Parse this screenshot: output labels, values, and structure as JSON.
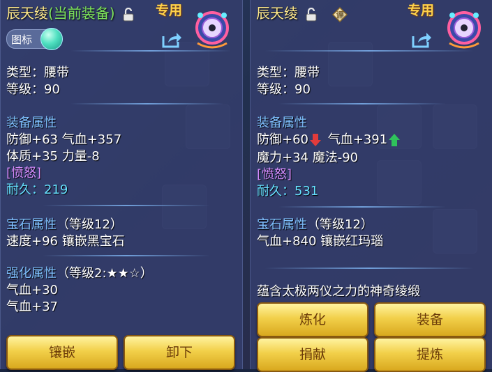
{
  "left_panel": {
    "item_name": "辰天绫",
    "current_equipped_tag": "(当前装备)",
    "exclusive": "专用",
    "icon_toggle_label": "图标",
    "type_line": "类型：腰带",
    "level_line": "等级：90",
    "equip_attr_title": "装备属性",
    "attr_line1": "防御+63 气血+357",
    "attr_line2": "体质+35 力量-8",
    "special": "[愤怒]",
    "durability_label": "耐久：",
    "durability_value": "219",
    "gem_title": "宝石属性",
    "gem_level": "（等级12）",
    "gem_line": "速度+96 镶嵌黑宝石",
    "enhance_title": "强化属性",
    "enhance_level": "（等级2:★★☆）",
    "enhance_line1": "气血+30",
    "enhance_line2": "气血+37",
    "buttons": {
      "inlay": "镶嵌",
      "unequip": "卸下"
    }
  },
  "right_panel": {
    "item_name": "辰天绫",
    "rating_badge": "评",
    "exclusive": "专用",
    "type_line": "类型：腰带",
    "level_line": "等级：90",
    "equip_attr_title": "装备属性",
    "attr_def": "防御+60",
    "attr_hp": "气血+391",
    "attr_line2": "魔力+34 魔法-90",
    "special": "[愤怒]",
    "durability_label": "耐久：",
    "durability_value": "531",
    "gem_title": "宝石属性",
    "gem_level": "（等级12）",
    "gem_line": "气血+840 镶嵌红玛瑙",
    "description": "蕴含太极两仪之力的神奇绫缎",
    "buttons": {
      "refine": "炼化",
      "equip": "装备",
      "donate": "捐献",
      "extract": "提炼"
    }
  },
  "colors": {
    "title": "#ffe98a",
    "current": "#7de35b",
    "section": "#7fc0ff",
    "special": "#d68cff",
    "durability": "#66e0ff",
    "button": "#f2d04a",
    "down_arrow": "#e23b3b",
    "up_arrow": "#2fc25b"
  },
  "icons": [
    "lock-icon",
    "share-icon",
    "mascot-icon",
    "rating-icon",
    "down-arrow-icon",
    "up-arrow-icon"
  ]
}
